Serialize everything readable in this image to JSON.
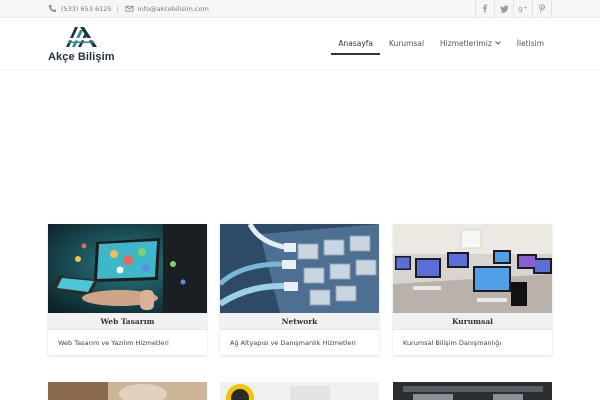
{
  "topbar": {
    "phone": "(533) 653 6125",
    "email": "info@akcebilisim.com",
    "social": [
      "facebook-icon",
      "twitter-icon",
      "google-plus-icon",
      "pinterest-icon"
    ]
  },
  "brand": {
    "name": "Akçe Bilişim"
  },
  "nav": {
    "items": [
      {
        "label": "Anasayfa"
      },
      {
        "label": "Kurumsal"
      },
      {
        "label": "Hizmetlerimiz"
      },
      {
        "label": "İletisim"
      }
    ]
  },
  "cards": [
    {
      "title": "Web Tasarım",
      "desc": "Web Tasarım ve Yazılım Hizmetleri"
    },
    {
      "title": "Network",
      "desc": "Ağ Altyapısı ve Danışmanlık Hizmetleri"
    },
    {
      "title": "Kurumsal",
      "desc": "Kurumsal Bilişim Danışmanlığı"
    }
  ],
  "colors": {
    "brand_dark": "#23323e",
    "brand_teal": "#2f8a9c",
    "nav_active": "#333333"
  }
}
